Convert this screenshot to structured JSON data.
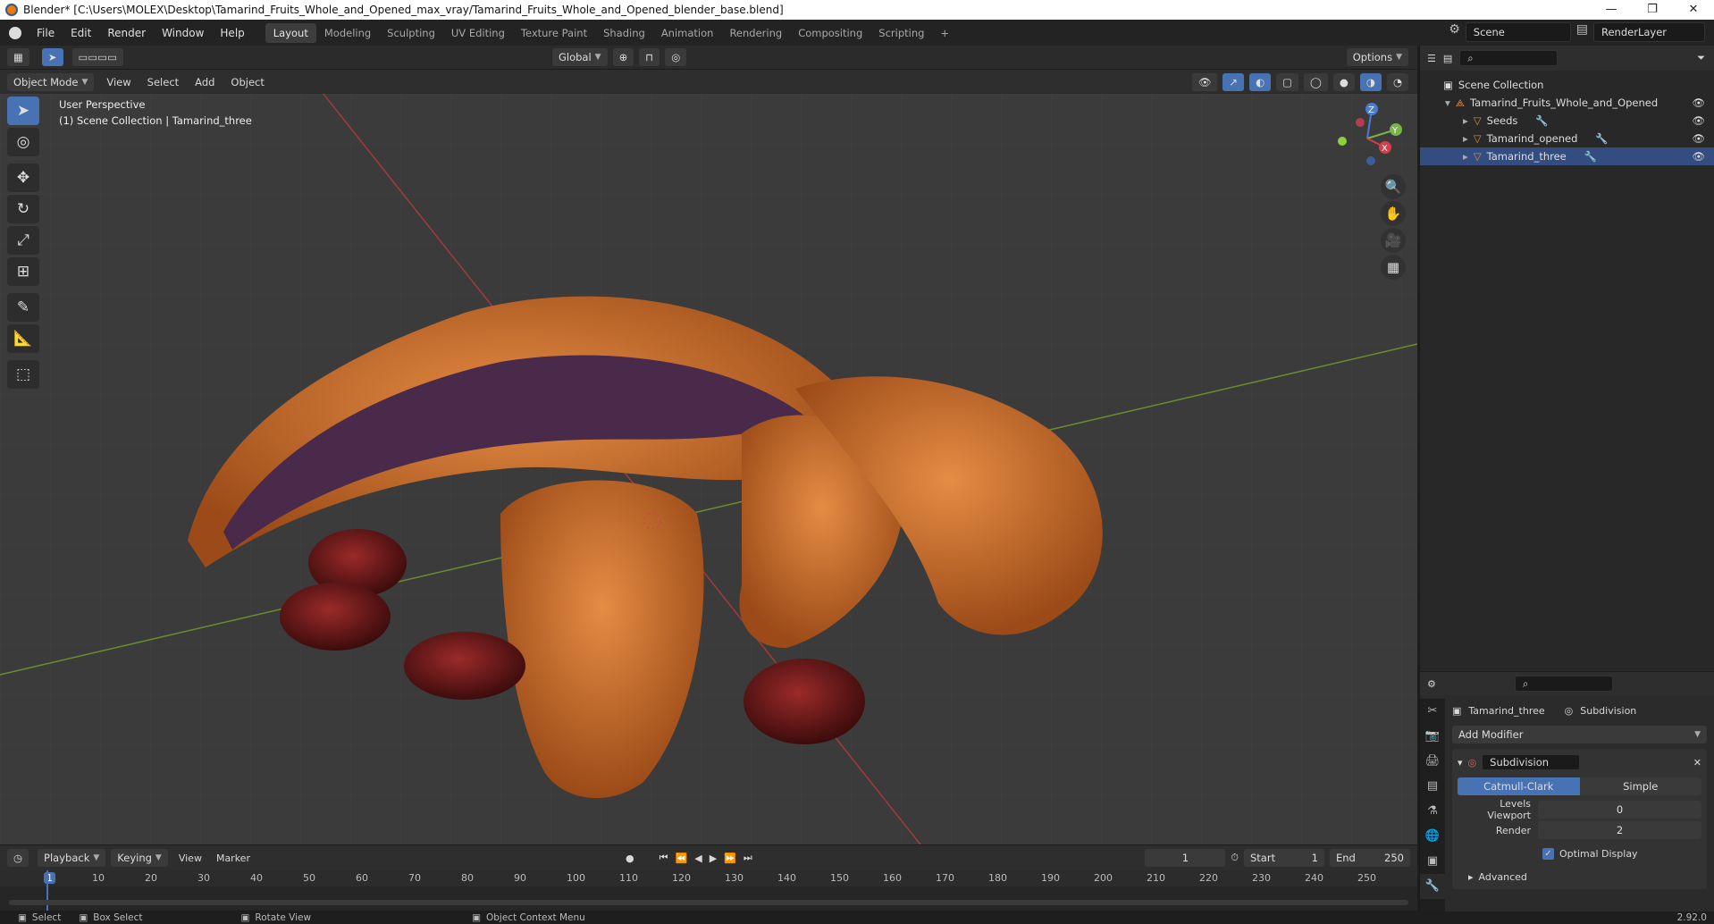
{
  "window": {
    "title": "Blender* [C:\\Users\\MOLEX\\Desktop\\Tamarind_Fruits_Whole_and_Opened_max_vray/Tamarind_Fruits_Whole_and_Opened_blender_base.blend]",
    "minimize": "—",
    "restore": "❐",
    "close": "✕"
  },
  "menu": [
    "File",
    "Edit",
    "Render",
    "Window",
    "Help"
  ],
  "workspaces": [
    "Layout",
    "Modeling",
    "Sculpting",
    "UV Editing",
    "Texture Paint",
    "Shading",
    "Animation",
    "Rendering",
    "Compositing",
    "Scripting",
    "+"
  ],
  "scene": {
    "name": "Scene",
    "render_layer": "RenderLayer"
  },
  "header": {
    "transform_orientation": "Global",
    "options": "Options",
    "mode": "Object Mode",
    "view": "View",
    "select": "Select",
    "add": "Add",
    "object": "Object"
  },
  "viewport": {
    "perspective": "User Perspective",
    "collection": "(1) Scene Collection | Tamarind_three"
  },
  "gizmo": {
    "x": "X",
    "y": "Y",
    "z": "Z"
  },
  "outliner": {
    "root": "Scene Collection",
    "collection": "Tamarind_Fruits_Whole_and_Opened",
    "items": [
      "Seeds",
      "Tamarind_opened",
      "Tamarind_three"
    ]
  },
  "properties": {
    "object": "Tamarind_three",
    "modifier_tab": "Subdivision",
    "add_modifier": "Add Modifier",
    "modifier_name": "Subdivision",
    "catmull": "Catmull-Clark",
    "simple": "Simple",
    "levels_viewport_label": "Levels Viewport",
    "levels_viewport": "0",
    "render_label": "Render",
    "render": "2",
    "optimal_display": "Optimal Display",
    "advanced": "Advanced"
  },
  "timeline": {
    "playback": "Playback",
    "keying": "Keying",
    "view": "View",
    "marker": "Marker",
    "current_frame": "1",
    "start_label": "Start",
    "start": "1",
    "end_label": "End",
    "end": "250",
    "ticks": [
      "1",
      "10",
      "20",
      "30",
      "40",
      "50",
      "60",
      "70",
      "80",
      "90",
      "100",
      "110",
      "120",
      "130",
      "140",
      "150",
      "160",
      "170",
      "180",
      "190",
      "200",
      "210",
      "220",
      "230",
      "240",
      "250"
    ]
  },
  "status": {
    "select": "Select",
    "box_select": "Box Select",
    "rotate_view": "Rotate View",
    "context_menu": "Object Context Menu",
    "version": "2.92.0"
  }
}
